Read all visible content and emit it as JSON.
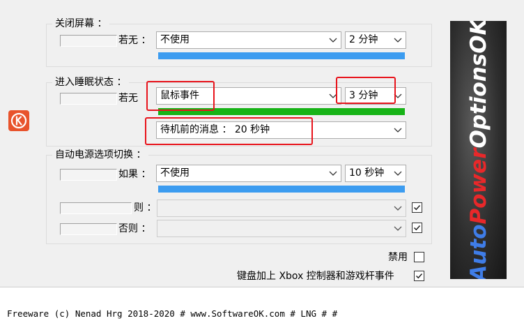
{
  "screen_off": {
    "title": "关闭屏幕 ：",
    "label": "若无 ：",
    "action": "不使用",
    "time": "2 分钟",
    "progress": 1.0,
    "progress_color": "#3c9cf0"
  },
  "sleep": {
    "title": "进入睡眠状态 ：",
    "label": "若无",
    "action": "鼠标事件",
    "time": "3 分钟",
    "progress": 1.0,
    "progress_color": "#17b317",
    "standby_message": "待机前的消息 ： 20 秒钟"
  },
  "auto_switch": {
    "title": "自动电源选项切换 ：",
    "if_label": "如果 ：",
    "if_action": "不使用",
    "if_time": "10 秒钟",
    "progress": 1.0,
    "progress_color": "#3c9cf0",
    "then_label": "则 ：",
    "then_value": "",
    "then_checked": true,
    "else_label": "否则 ：",
    "else_value": "",
    "else_checked": true
  },
  "options": {
    "disable_label": "禁用",
    "disable_checked": false,
    "keyboard_label": "键盘加上 Xbox 控制器和游戏杆事件",
    "keyboard_checked": true
  },
  "banner": {
    "auto": "Auto",
    "power": "Power",
    "options": "OptionsOK",
    "auto_color": "#3f7de8",
    "power_color": "#e8282a",
    "options_color": "#ffffff"
  },
  "status": {
    "text": "Freeware (c) Nenad Hrg 2018-2020 # www.SoftwareOK.com  # LNG  #   #"
  },
  "colors": {
    "highlight_box": "#e8131b",
    "app_icon": "#e8532c"
  },
  "icons": {
    "app": "app-logo-icon",
    "dropdown": "chevron-down-icon",
    "check": "checkmark-icon"
  }
}
